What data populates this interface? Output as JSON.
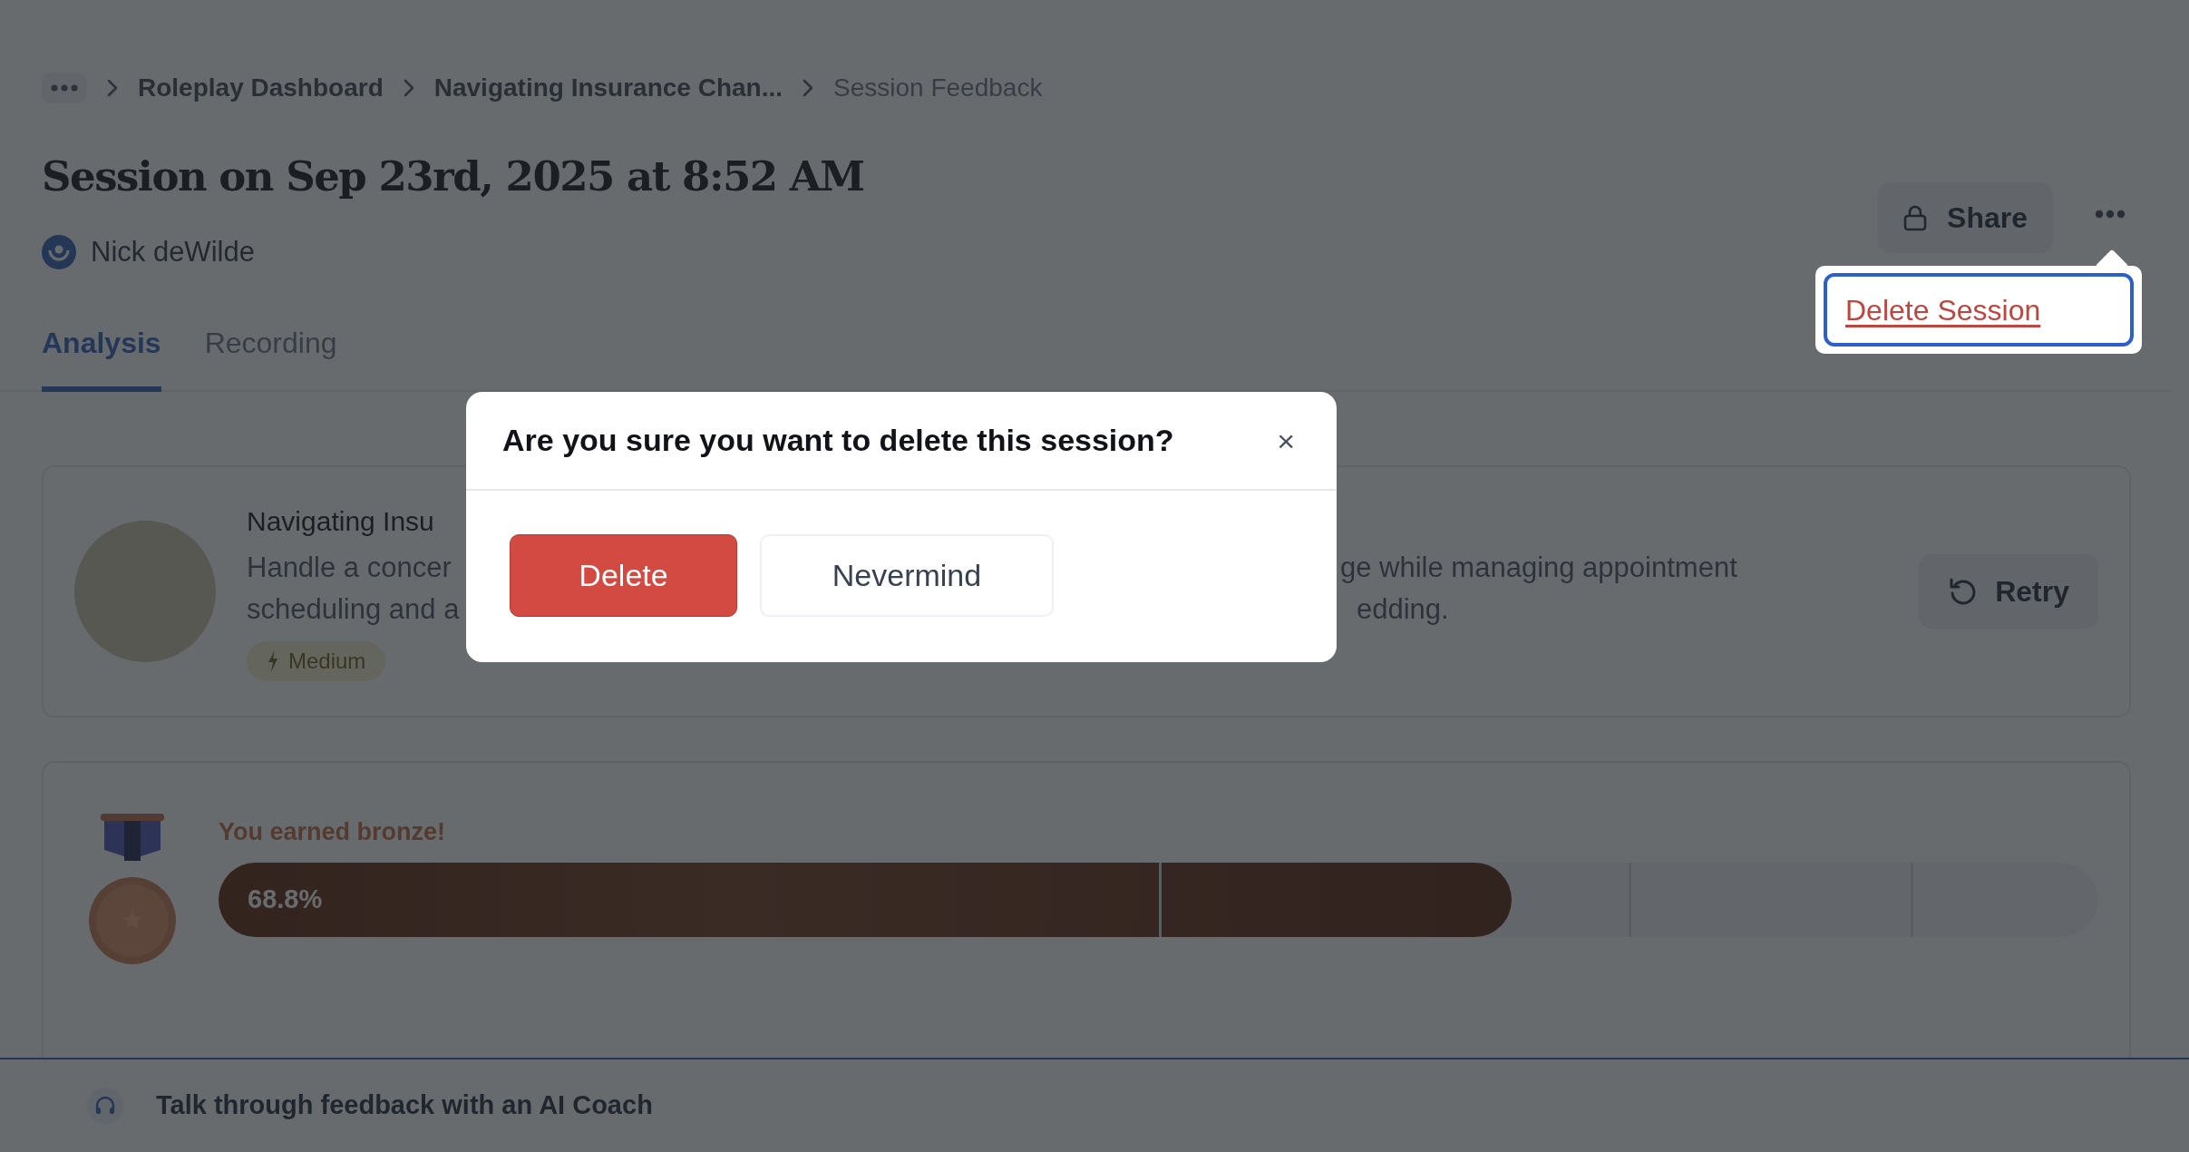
{
  "breadcrumb": {
    "items": [
      {
        "label": "Roleplay Dashboard",
        "current": false
      },
      {
        "label": "Navigating Insurance Chan...",
        "current": false
      },
      {
        "label": "Session Feedback",
        "current": true
      }
    ]
  },
  "title": "Session on Sep 23rd, 2025 at 8:52 AM",
  "user": {
    "name": "Nick deWilde"
  },
  "tabs": [
    {
      "label": "Analysis",
      "selected": true
    },
    {
      "label": "Recording",
      "selected": false
    }
  ],
  "share": {
    "label": "Share"
  },
  "dropdown": {
    "items": [
      {
        "label": "Delete Session",
        "focused": true
      }
    ]
  },
  "scenario_card": {
    "title": "Navigating Insu",
    "description_left": [
      "Handle a concer",
      "scheduling and a"
    ],
    "description_right": [
      "ge while managing appointment",
      "edding."
    ],
    "difficulty": "Medium",
    "retry": "Retry"
  },
  "score_card": {
    "message": "You earned bronze!",
    "progress": {
      "level": 0.688,
      "reading": "68.8%"
    }
  },
  "modal": {
    "title": "Are you sure you want to delete this session?",
    "close": "×",
    "buttons": [
      {
        "label": "Delete",
        "kind": "danger"
      },
      {
        "label": "Nevermind",
        "kind": "secondary"
      }
    ]
  },
  "coach_bar": {
    "label": "Talk through feedback with an AI Coach"
  }
}
